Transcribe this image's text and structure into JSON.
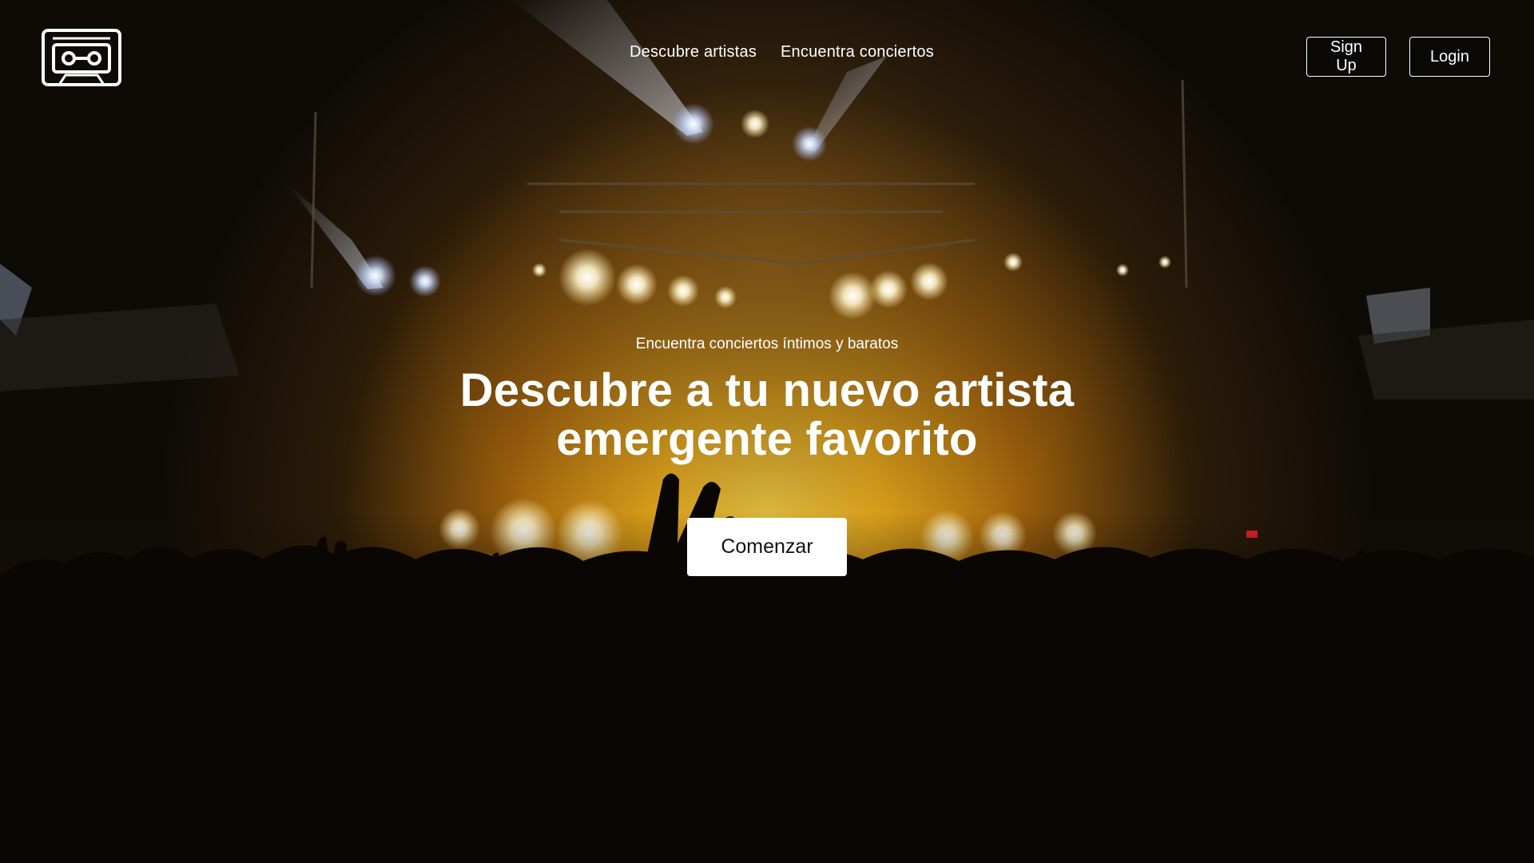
{
  "header": {
    "logo_icon": "cassette-tape-icon",
    "nav": [
      {
        "label": "Descubre artistas"
      },
      {
        "label": "Encuentra conciertos"
      }
    ],
    "signup_label": "Sign Up",
    "login_label": "Login"
  },
  "hero": {
    "tagline": "Encuentra conciertos íntimos y baratos",
    "headline_line1": "Descubre a tu nuevo artista",
    "headline_line2": "emergente favorito",
    "cta_label": "Comenzar",
    "background": "concert-crowd-stage-lights-photo"
  },
  "colors": {
    "text": "#ffffff",
    "cta_bg": "#ffffff",
    "cta_text": "#111111",
    "glow": "#f2b01c"
  }
}
